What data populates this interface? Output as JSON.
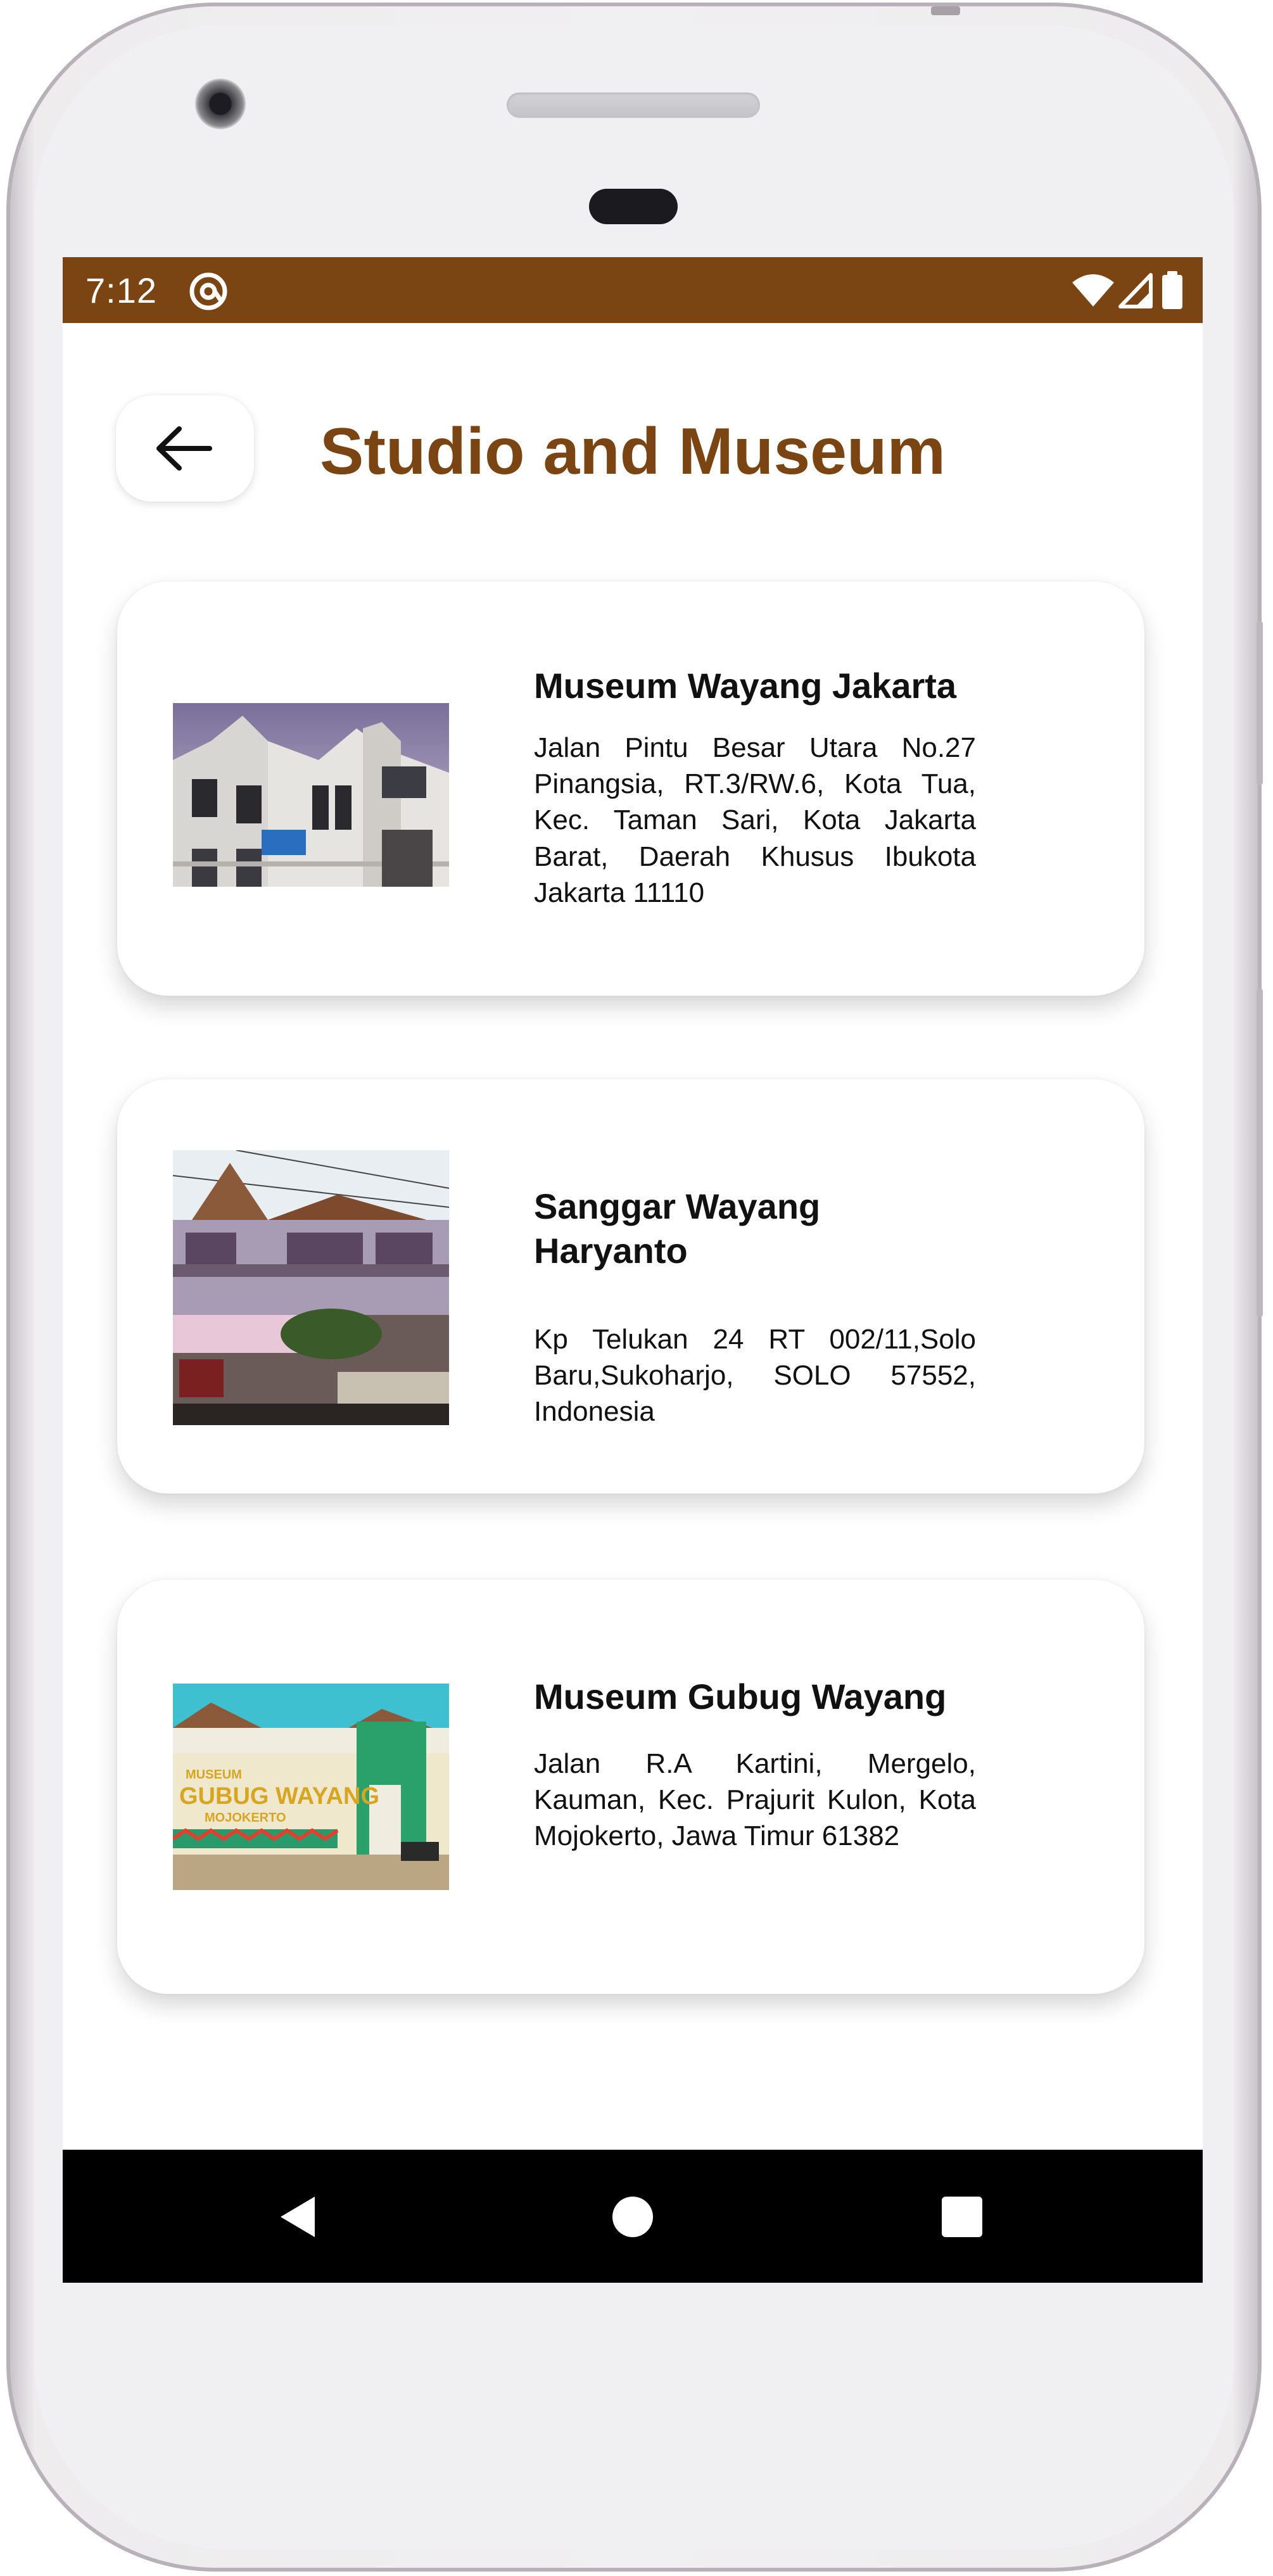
{
  "status_bar": {
    "time": "7:12",
    "app_icon": "at-sign-icon",
    "icons": [
      "wifi-icon",
      "cell-signal-icon",
      "battery-icon"
    ],
    "background_color": "#7a4413"
  },
  "header": {
    "back_icon": "arrow-left-icon",
    "title": "Studio and Museum",
    "title_color": "#7a4413"
  },
  "places": [
    {
      "name": "Museum Wayang Jakarta",
      "address": "Jalan Pintu Besar Utara No.27 Pinangsia, RT.3/RW.6, Kota Tua, Kec. Taman Sari, Kota Jakarta Barat, Daerah Khusus Ibukota Jakarta 11110",
      "image": "museum-building-photo"
    },
    {
      "name": "Sanggar Wayang Haryanto",
      "address": "Kp Telukan 24 RT 002/11,Solo Baru,Sukoharjo, SOLO 57552, Indonesia",
      "image": "studio-house-photo"
    },
    {
      "name": "Museum Gubug Wayang",
      "address": "Jalan R.A Kartini, Mergelo, Kauman, Kec. Prajurit Kulon, Kota Mojokerto, Jawa Timur 61382",
      "image": "museum-gubug-wayang-photo",
      "image_sign_text": [
        "MUSEUM",
        "GUBUG WAYANG",
        "MOJOKERTO"
      ]
    }
  ],
  "nav_bar": {
    "icons": [
      "back-triangle-icon",
      "home-circle-icon",
      "recents-square-icon"
    ]
  }
}
